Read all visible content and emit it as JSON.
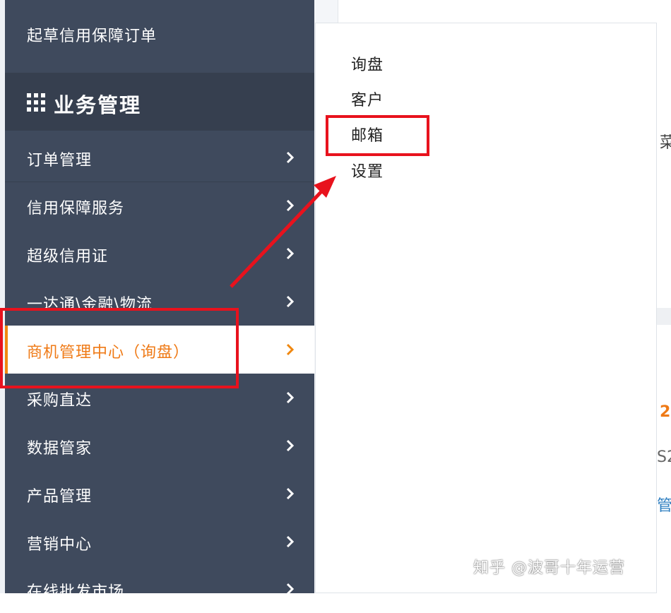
{
  "sidebar": {
    "top_item": "起草信用保障订单",
    "section_title": "业务管理",
    "items": [
      {
        "label": "订单管理"
      },
      {
        "label": "信用保障服务"
      },
      {
        "label": "超级信用证"
      },
      {
        "label": "一达通\\金融\\物流"
      },
      {
        "label": "商机管理中心（询盘）",
        "active": true
      },
      {
        "label": "采购直达"
      },
      {
        "label": "数据管家"
      },
      {
        "label": "产品管理"
      },
      {
        "label": "营销中心"
      },
      {
        "label": "在线批发市场"
      }
    ]
  },
  "submenu": {
    "items": [
      {
        "label": "询盘"
      },
      {
        "label": "客户"
      },
      {
        "label": "邮箱"
      },
      {
        "label": "设置"
      }
    ]
  },
  "background_fragments": {
    "f1": "菜",
    "f2": "2",
    "f3": "S2",
    "f4": "管"
  },
  "watermark": "知乎 @波哥十年运营",
  "colors": {
    "sidebar_bg": "#3f4a5d",
    "active_text": "#ef7a16",
    "annotation_red": "#e8121d"
  }
}
